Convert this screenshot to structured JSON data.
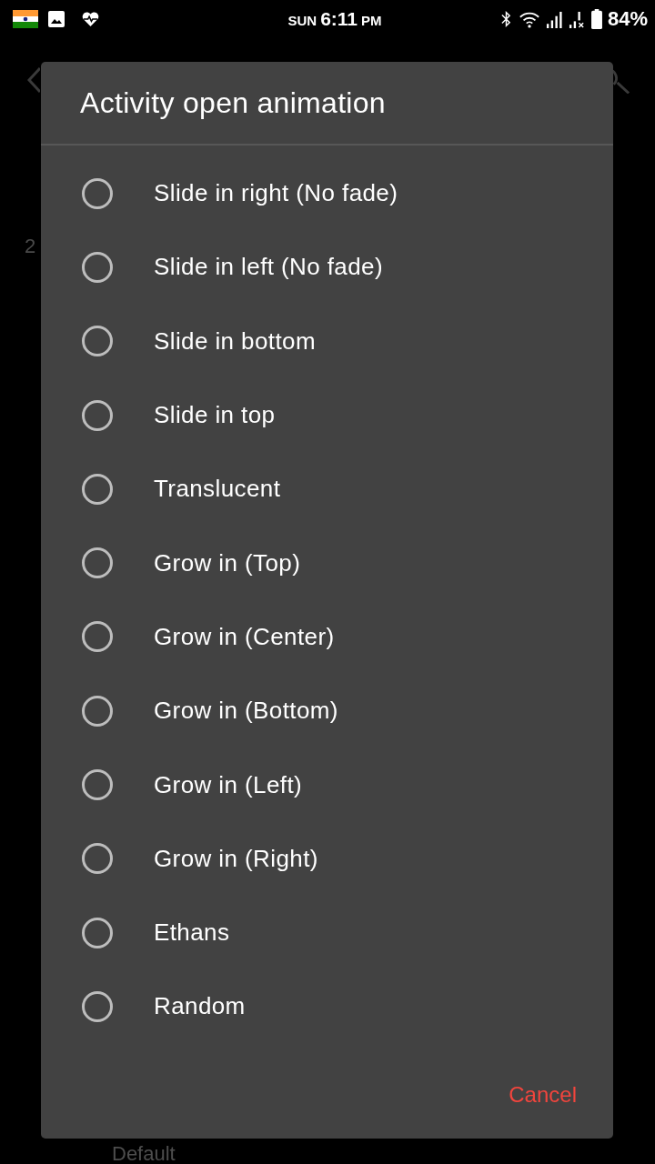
{
  "status_bar": {
    "day": "SUN",
    "time": "6:11",
    "period": "PM",
    "battery": "84%"
  },
  "behind_dialog": {
    "text_fragment": "2",
    "summary": "Default"
  },
  "dialog": {
    "title": "Activity open animation",
    "options": [
      {
        "label": "Slide in right (No fade)",
        "selected": false
      },
      {
        "label": "Slide in left (No fade)",
        "selected": false
      },
      {
        "label": "Slide in bottom",
        "selected": false
      },
      {
        "label": "Slide in top",
        "selected": false
      },
      {
        "label": "Translucent",
        "selected": false
      },
      {
        "label": "Grow in (Top)",
        "selected": false
      },
      {
        "label": "Grow in (Center)",
        "selected": false
      },
      {
        "label": "Grow in (Bottom)",
        "selected": false
      },
      {
        "label": "Grow in (Left)",
        "selected": false
      },
      {
        "label": "Grow in (Right)",
        "selected": false
      },
      {
        "label": "Ethans",
        "selected": false
      },
      {
        "label": "Random",
        "selected": false
      }
    ],
    "buttons": [
      {
        "label": "Cancel"
      }
    ]
  }
}
